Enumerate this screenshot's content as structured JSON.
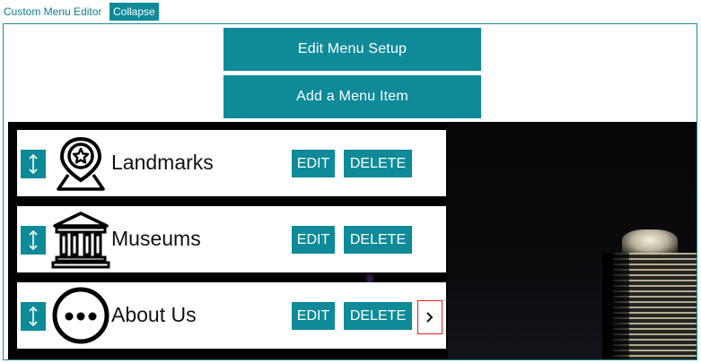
{
  "header": {
    "title": "Custom Menu Editor",
    "collapse_label": "Collapse"
  },
  "actions": {
    "edit_setup_label": "Edit Menu Setup",
    "add_item_label": "Add a Menu Item"
  },
  "menu_items": [
    {
      "label": "Landmarks",
      "icon": "map-pin-star-icon",
      "edit_label": "EDIT",
      "delete_label": "DELETE"
    },
    {
      "label": "Museums",
      "icon": "museum-building-icon",
      "edit_label": "EDIT",
      "delete_label": "DELETE"
    },
    {
      "label": "About Us",
      "icon": "more-dots-icon",
      "edit_label": "EDIT",
      "delete_label": "DELETE",
      "has_submenu_arrow": true
    }
  ],
  "colors": {
    "accent": "#0e8a99",
    "highlight_border": "#e0201b",
    "background_dark": "#000000"
  }
}
